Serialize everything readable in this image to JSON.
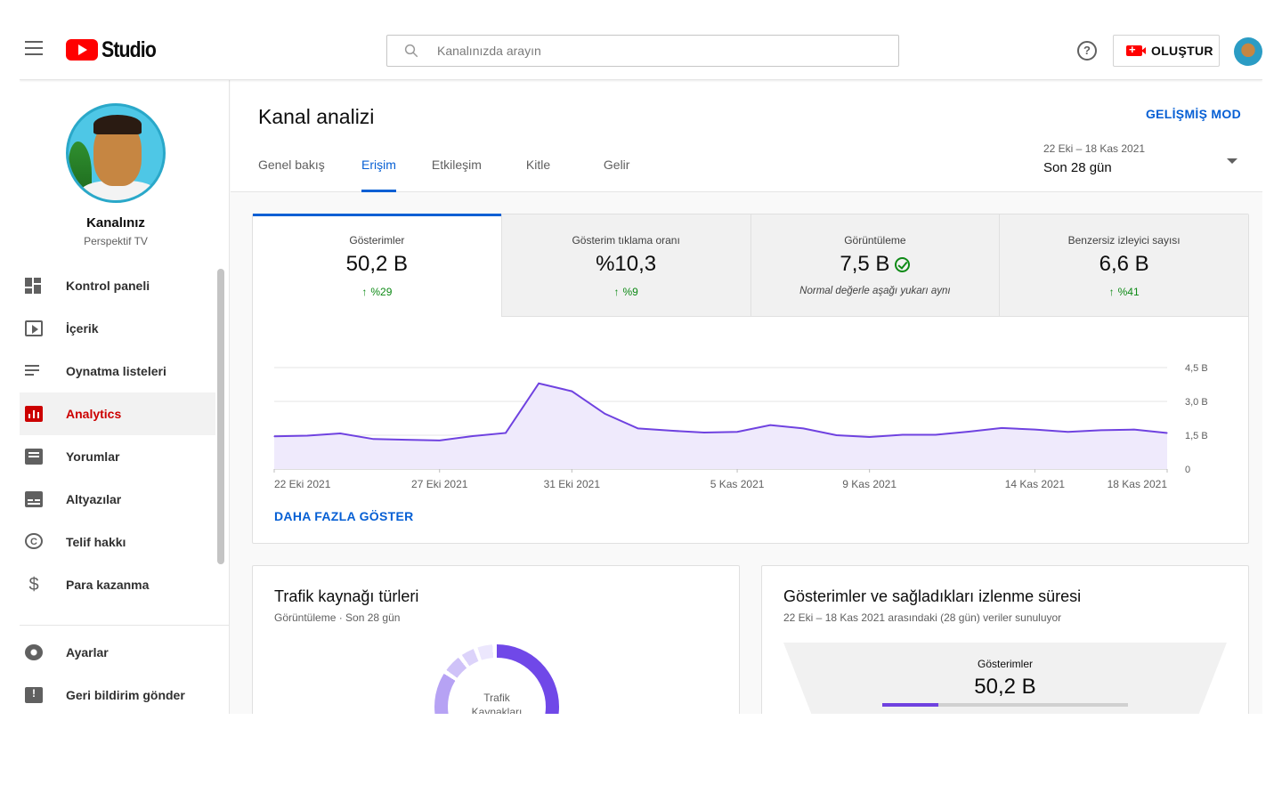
{
  "topbar": {
    "logo_text": "Studio",
    "search_placeholder": "Kanalınızda arayın",
    "help_label": "?",
    "create_label": "OLUŞTUR"
  },
  "channel": {
    "name": "Kanalınız",
    "subtitle": "Perspektif TV"
  },
  "sidebar": {
    "items": [
      {
        "label": "Kontrol paneli",
        "icon": "dashboard-icon",
        "active": false
      },
      {
        "label": "İçerik",
        "icon": "content-icon",
        "active": false
      },
      {
        "label": "Oynatma listeleri",
        "icon": "playlist-icon",
        "active": false
      },
      {
        "label": "Analytics",
        "icon": "analytics-icon",
        "active": true
      },
      {
        "label": "Yorumlar",
        "icon": "comments-icon",
        "active": false
      },
      {
        "label": "Altyazılar",
        "icon": "subtitles-icon",
        "active": false
      },
      {
        "label": "Telif hakkı",
        "icon": "copyright-icon",
        "active": false
      },
      {
        "label": "Para kazanma",
        "icon": "dollar-icon",
        "active": false
      }
    ],
    "bottom_items": [
      {
        "label": "Ayarlar",
        "icon": "settings-icon"
      },
      {
        "label": "Geri bildirim gönder",
        "icon": "feedback-icon"
      }
    ]
  },
  "header": {
    "title": "Kanal analizi",
    "advanced_mode": "GELİŞMİŞ MOD",
    "tabs": [
      {
        "label": "Genel bakış",
        "active": false
      },
      {
        "label": "Erişim",
        "active": true
      },
      {
        "label": "Etkileşim",
        "active": false
      },
      {
        "label": "Kitle",
        "active": false
      },
      {
        "label": "Gelir",
        "active": false
      }
    ],
    "date_range": "22 Eki – 18 Kas 2021",
    "date_period": "Son 28 gün"
  },
  "metrics": [
    {
      "label": "Gösterimler",
      "value": "50,2 B",
      "delta": "%29",
      "active": true
    },
    {
      "label": "Gösterim tıklama oranı",
      "value": "%10,3",
      "delta": "%9",
      "active": false
    },
    {
      "label": "Görüntüleme",
      "value": "7,5 B",
      "note": "Normal değerle aşağı yukarı aynı",
      "active": false
    },
    {
      "label": "Benzersiz izleyici sayısı",
      "value": "6,6 B",
      "delta": "%41",
      "active": false
    }
  ],
  "show_more": "DAHA FAZLA GÖSTER",
  "colors": {
    "accent": "#065fd4",
    "active_nav": "#cc0000",
    "positive": "#0e8a16",
    "chart_line": "#6f42e0",
    "chart_fill": "#efeafc"
  },
  "chart_data": {
    "type": "area",
    "series": [
      {
        "values": [
          1.45,
          1.48,
          1.58,
          1.33,
          1.3,
          1.27,
          1.46,
          1.6,
          3.8,
          3.45,
          2.45,
          1.8,
          1.7,
          1.62,
          1.65,
          1.95,
          1.8,
          1.5,
          1.42,
          1.52,
          1.52,
          1.66,
          1.82,
          1.75,
          1.65,
          1.72,
          1.75,
          1.6
        ]
      }
    ],
    "x_tick_labels": [
      "22 Eki 2021",
      "27 Eki 2021",
      "31 Eki 2021",
      "5 Kas 2021",
      "9 Kas 2021",
      "14 Kas 2021",
      "18 Kas 2021"
    ],
    "x_tick_index": [
      0,
      5,
      9,
      14,
      18,
      23,
      27
    ],
    "y_tick_labels": [
      "4,5 B",
      "3,0 B",
      "1,5 B",
      "0"
    ],
    "y_tick_values": [
      4.5,
      3.0,
      1.5,
      0
    ],
    "ylim": [
      0,
      4.5
    ],
    "grid": true
  },
  "traffic_card": {
    "title": "Trafik kaynağı türleri",
    "subtitle": "Görüntüleme · Son 28 gün",
    "donut_label_1": "Trafik",
    "donut_label_2": "Kaynakları"
  },
  "funnel_card": {
    "title": "Gösterimler ve sağladıkları izlenme süresi",
    "subtitle": "22 Eki – 18 Kas 2021 arasındaki (28 gün) veriler sunuluyor",
    "label": "Gösterimler",
    "value": "50,2 B",
    "fill_fraction": 0.23
  }
}
